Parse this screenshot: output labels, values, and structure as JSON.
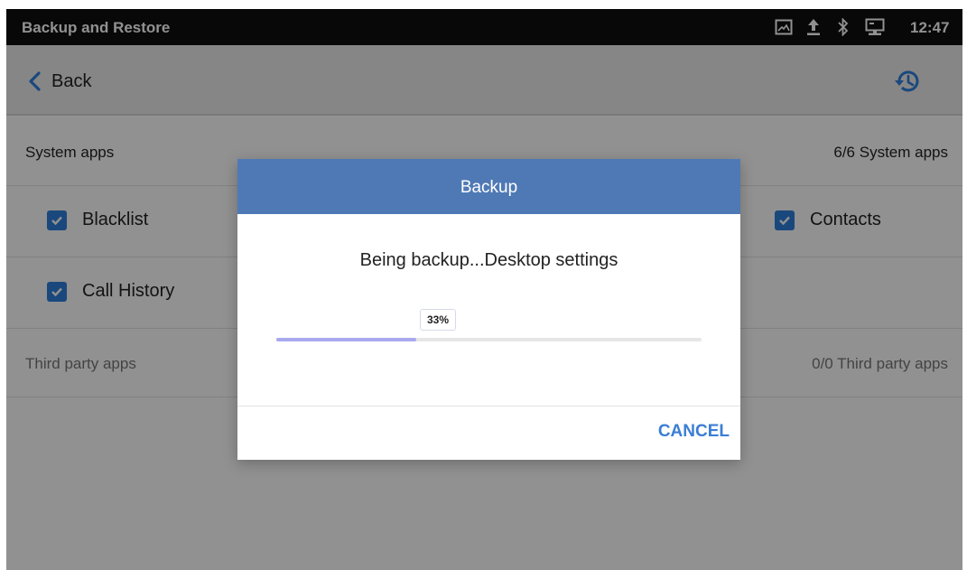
{
  "status_bar": {
    "title": "Backup and Restore",
    "time": "12:47",
    "icons": [
      "screenshot-icon",
      "upload-icon",
      "bluetooth-icon",
      "network-icon"
    ]
  },
  "header": {
    "back_label": "Back",
    "history_icon": "history-icon"
  },
  "system_apps": {
    "label": "System apps",
    "count": "6/6  System apps",
    "items": [
      {
        "label": "Blacklist",
        "checked": true
      },
      {
        "label": "Contacts",
        "checked": true
      },
      {
        "label": "Call History",
        "checked": true
      }
    ]
  },
  "third_party_apps": {
    "label": "Third party apps",
    "count": "0/0  Third party apps"
  },
  "dialog": {
    "title": "Backup",
    "message": "Being backup...Desktop settings",
    "progress_label": "33%",
    "progress_fraction": 0.33,
    "cancel_label": "CANCEL"
  },
  "colors": {
    "dialog_header": "#4f79b5",
    "checkbox": "#2f7fdc",
    "progress_fill": "#a9a9ef",
    "cancel": "#3b7ed6"
  }
}
